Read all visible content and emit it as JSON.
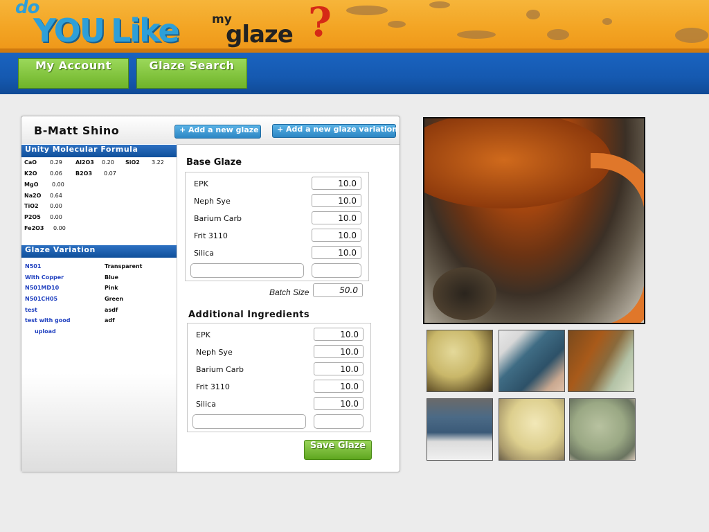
{
  "logo": {
    "do": "do",
    "you": "YOU",
    "like": "Like",
    "my": "my",
    "glaze": "glaze",
    "mark": "?"
  },
  "nav": {
    "account": "My Account",
    "search": "Glaze Search"
  },
  "glaze": {
    "name": "B-Matt Shino",
    "add_glaze": "+ Add a new glaze",
    "add_variation": "+ Add a new glaze variation"
  },
  "unity": {
    "title": "Unity Molecular Formula",
    "items": [
      {
        "oxide": "CaO",
        "value": "0.29"
      },
      {
        "oxide": "Al2O3",
        "value": "0.20"
      },
      {
        "oxide": "SiO2",
        "value": "3.22"
      },
      {
        "oxide": "K2O",
        "value": "0.06"
      },
      {
        "oxide": "B2O3",
        "value": "0.07"
      },
      {
        "oxide": "MgO",
        "value": "0.00"
      },
      {
        "oxide": "Na2O",
        "value": "0.64"
      },
      {
        "oxide": "TiO2",
        "value": "0.00"
      },
      {
        "oxide": "P2O5",
        "value": "0.00"
      },
      {
        "oxide": "Fe2O3",
        "value": "0.00"
      }
    ]
  },
  "variations": {
    "title": "Glaze Variation",
    "items": [
      {
        "name": "N501",
        "color": "Transparent"
      },
      {
        "name": "With Copper",
        "color": "Blue"
      },
      {
        "name": "N501MD10",
        "color": "Pink"
      },
      {
        "name": "N501CH05",
        "color": "Green"
      },
      {
        "name": "test",
        "color": "asdf"
      },
      {
        "name": "test with good",
        "color": "adf"
      },
      {
        "name": "upload",
        "color": ""
      }
    ]
  },
  "base": {
    "title": "Base Glaze",
    "rows": [
      {
        "name": "EPK",
        "amount": "10.0"
      },
      {
        "name": "Neph Sye",
        "amount": "10.0"
      },
      {
        "name": "Barium Carb",
        "amount": "10.0"
      },
      {
        "name": "Frit 3110",
        "amount": "10.0"
      },
      {
        "name": "Silica",
        "amount": "10.0"
      }
    ],
    "new_name": "",
    "new_amount": "",
    "batch_label": "Batch Size",
    "batch_size": "50.0"
  },
  "additional": {
    "title": "Additional Ingredients",
    "rows": [
      {
        "name": "EPK",
        "amount": "10.0"
      },
      {
        "name": "Neph Sye",
        "amount": "10.0"
      },
      {
        "name": "Barium Carb",
        "amount": "10.0"
      },
      {
        "name": "Frit 3110",
        "amount": "10.0"
      },
      {
        "name": "Silica",
        "amount": "10.0"
      }
    ],
    "new_name": "",
    "new_amount": ""
  },
  "save_label": "Save Glaze",
  "colors": {
    "nav_blue": "#1559b0",
    "accent_green": "#6fb429",
    "header_orange": "#f3a423"
  }
}
